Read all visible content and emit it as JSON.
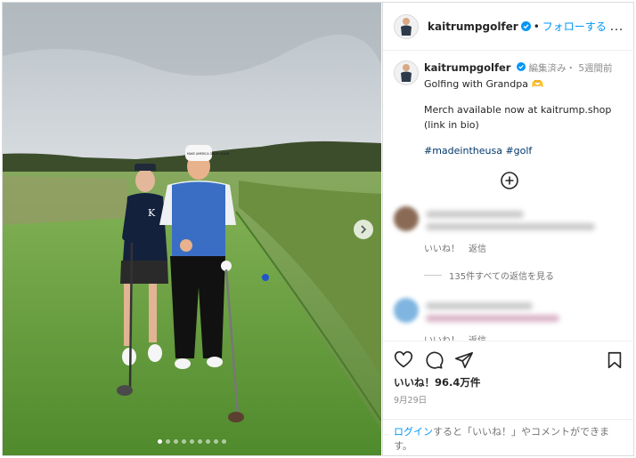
{
  "post": {
    "username": "kaitrumpgolfer",
    "follow_separator": "•",
    "follow_label": "フォローする",
    "more_icon": "…",
    "caption_meta": "編集済み・ 5週間前",
    "caption_line1": "Golfing with Grandpa 🫶",
    "caption_line2": "Merch available now at kaitrump.shop",
    "caption_line3": "(link in bio)",
    "hashtags": "#madeintheusa #golf",
    "likes": "いいね！96.4万件",
    "date": "9月29日"
  },
  "comments": {
    "like_label": "いいね！",
    "reply_label": "返信",
    "view_replies": "135件すべての返信を見る"
  },
  "footer": {
    "login_link": "ログイン",
    "login_rest": "すると「いいね！」やコメントができます。"
  },
  "photo": {
    "hat_text": "MAKE AMERICA GREAT AGAIN",
    "shirt_monogram": "K",
    "carousel_total": 9,
    "carousel_active": 1
  },
  "colors": {
    "accent": "#0095f6",
    "hashtag": "#00376b",
    "verified": "#0095f6"
  },
  "icons": {
    "verified": "verified-badge-icon",
    "next": "chevron-right-icon",
    "plus": "plus-circle-icon",
    "like": "heart-icon",
    "comment": "comment-bubble-icon",
    "share": "paper-plane-icon",
    "save": "bookmark-icon"
  }
}
